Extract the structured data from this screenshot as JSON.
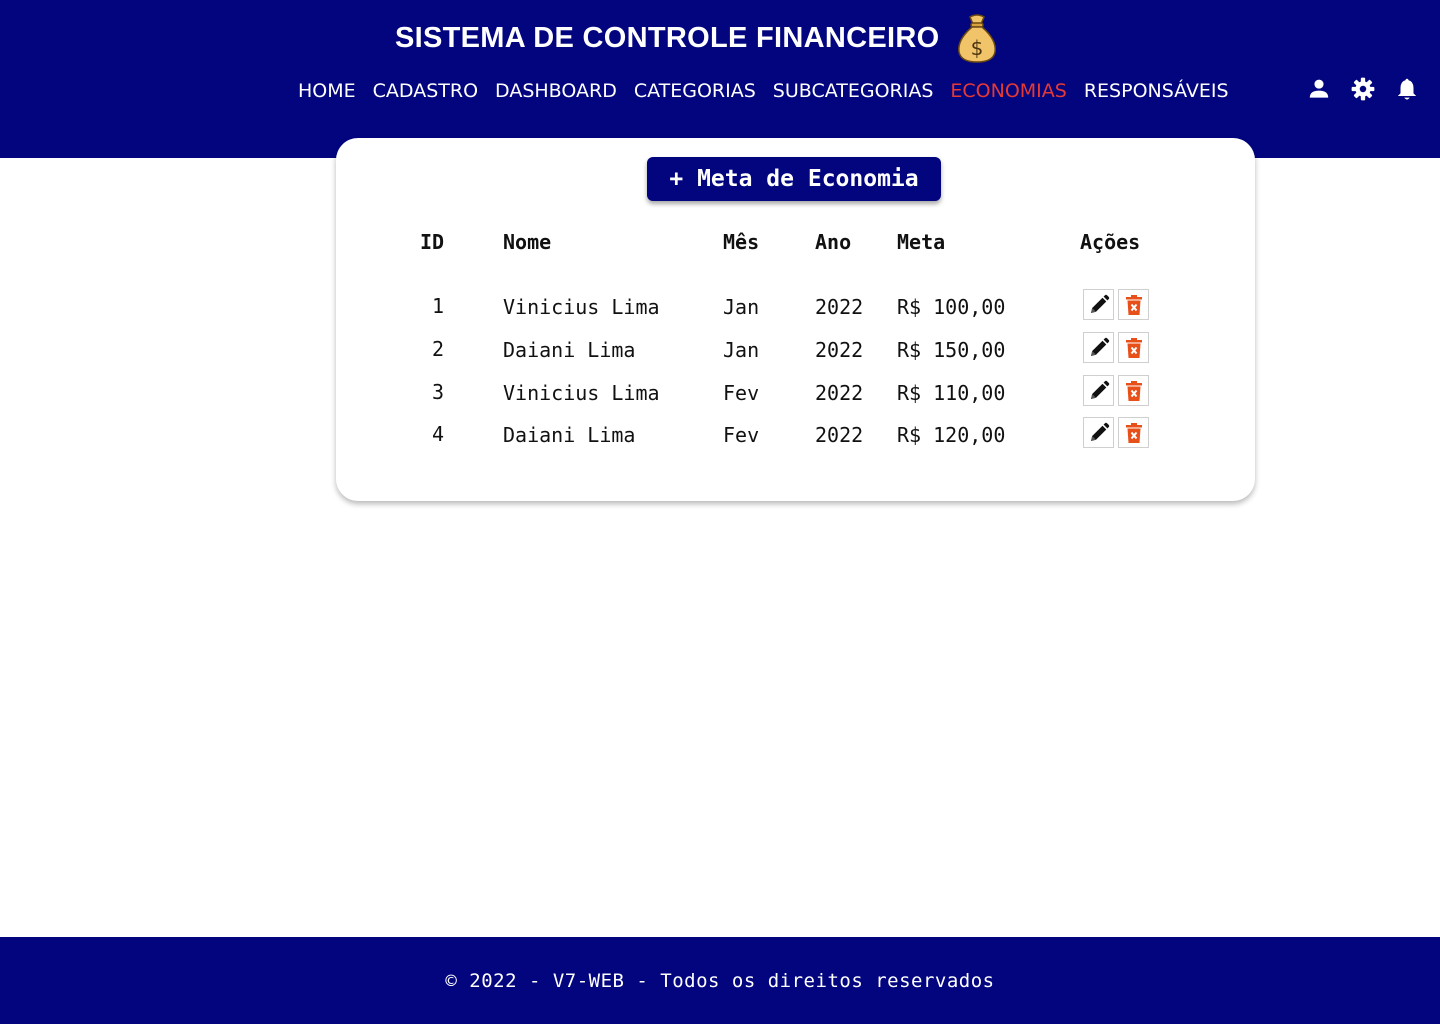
{
  "header": {
    "title": "SISTEMA DE CONTROLE FINANCEIRO",
    "title_icon": "money-bag-icon",
    "nav": [
      {
        "label": "HOME",
        "active": false
      },
      {
        "label": "CADASTRO",
        "active": false
      },
      {
        "label": "DASHBOARD",
        "active": false
      },
      {
        "label": "CATEGORIAS",
        "active": false
      },
      {
        "label": "SUBCATEGORIAS",
        "active": false
      },
      {
        "label": "ECONOMIAS",
        "active": true
      },
      {
        "label": "RESPONSÁVEIS",
        "active": false
      }
    ],
    "icons": [
      "user-icon",
      "gear-icon",
      "bell-icon"
    ]
  },
  "main": {
    "add_button": "+ Meta de Economia",
    "table": {
      "columns": [
        "ID",
        "Nome",
        "Mês",
        "Ano",
        "Meta",
        "Ações"
      ],
      "rows": [
        {
          "id": "1",
          "nome": "Vinicius Lima",
          "mes": "Jan",
          "ano": "2022",
          "meta": "R$ 100,00"
        },
        {
          "id": "2",
          "nome": "Daiani Lima",
          "mes": "Jan",
          "ano": "2022",
          "meta": "R$ 150,00"
        },
        {
          "id": "3",
          "nome": "Vinicius Lima",
          "mes": "Fev",
          "ano": "2022",
          "meta": "R$ 110,00"
        },
        {
          "id": "4",
          "nome": "Daiani Lima",
          "mes": "Fev",
          "ano": "2022",
          "meta": "R$ 120,00"
        }
      ],
      "row_actions": [
        "pencil-icon",
        "trash-icon"
      ]
    }
  },
  "footer": {
    "text": "© 2022 - V7-WEB - Todos os direitos reservados"
  },
  "colors": {
    "primary": "#02057e",
    "active_nav": "#e53935",
    "delete": "#e8501a",
    "money_bag": "#f2c46a"
  }
}
